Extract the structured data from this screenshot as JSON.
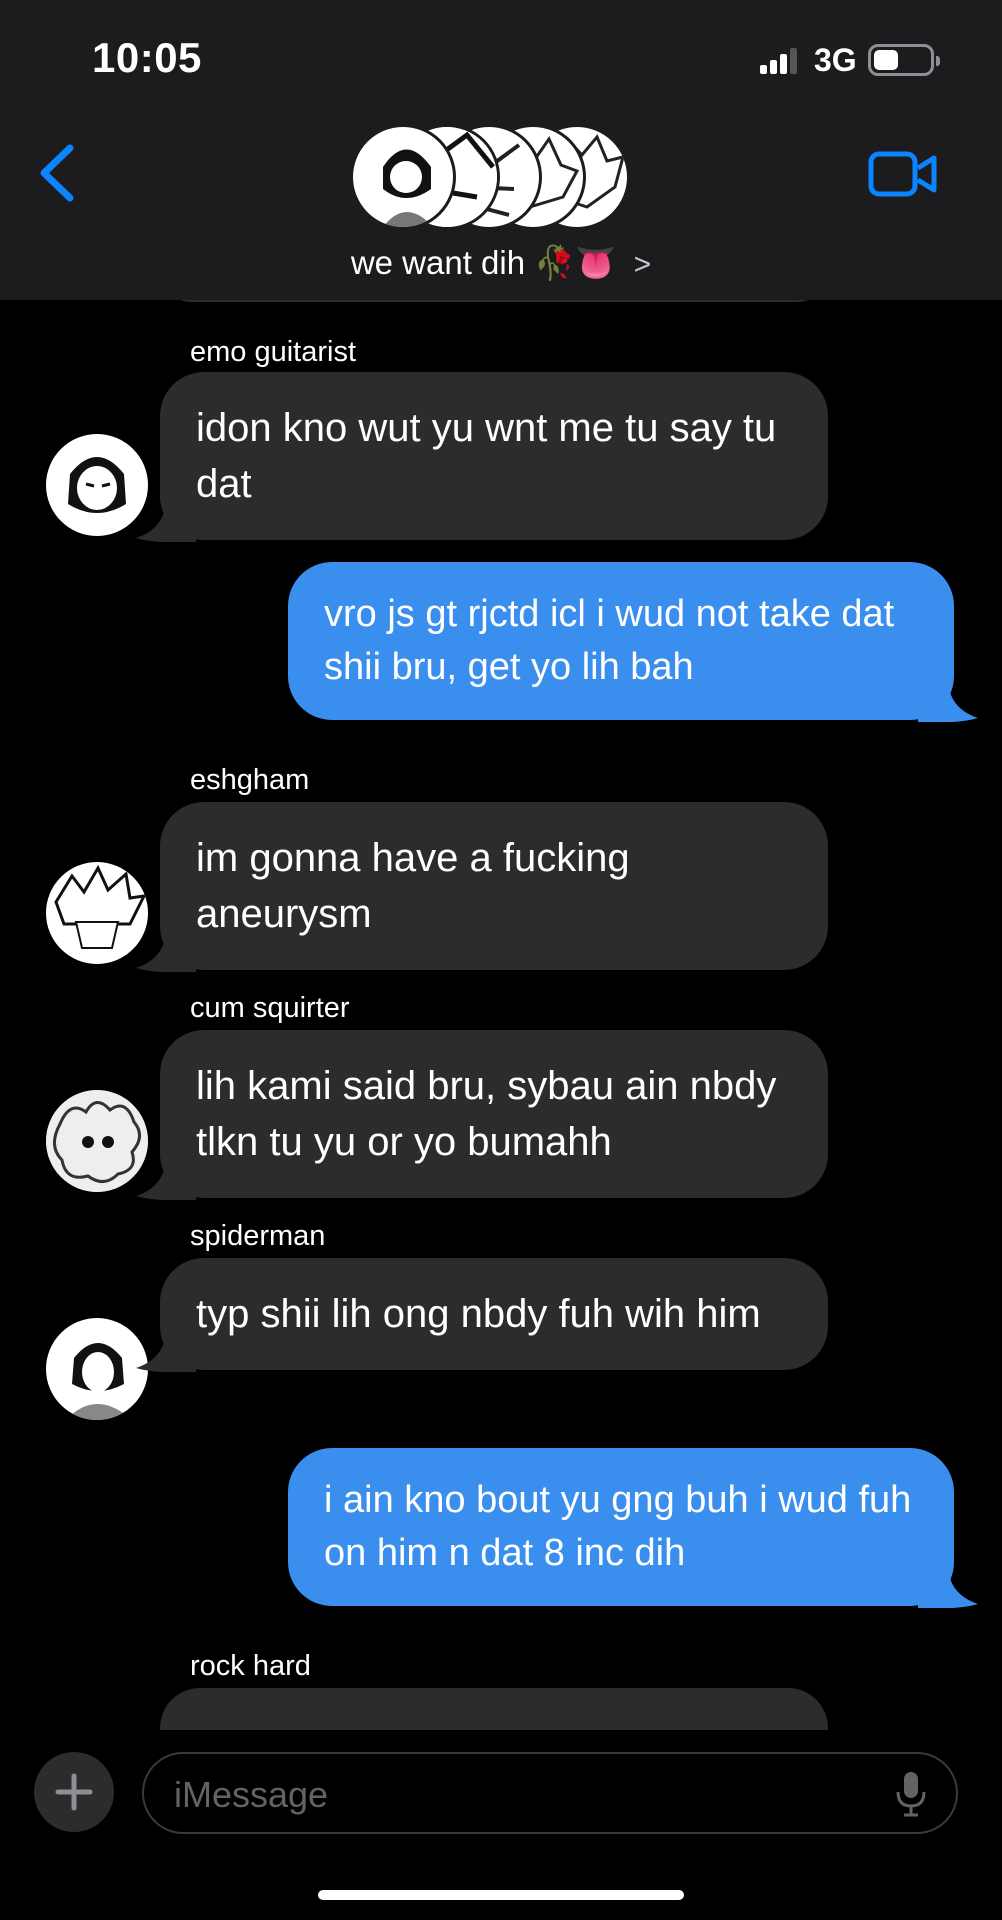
{
  "status": {
    "time": "10:05",
    "network": "3G"
  },
  "header": {
    "group_name": "we want dih",
    "group_emoji": "🥀👅",
    "chevron": ">"
  },
  "messages": [
    {
      "sender": "emo guitarist",
      "text": "idon kno wut yu wnt me tu say tu dat",
      "direction": "incoming"
    },
    {
      "text": "vro js gt rjctd icl i wud not take dat shii bru, get yo lih bah",
      "direction": "outgoing"
    },
    {
      "sender": "eshgham",
      "text": "im gonna have a fucking aneurysm",
      "direction": "incoming"
    },
    {
      "sender": "cum squirter",
      "text": "lih kami said bru, sybau ain nbdy tlkn tu yu or yo bumahh",
      "direction": "incoming"
    },
    {
      "sender": "spiderman",
      "text": "typ shii lih ong nbdy fuh wih him",
      "direction": "incoming"
    },
    {
      "text": "i ain kno bout yu gng buh i wud fuh on him n dat 8 inc dih",
      "direction": "outgoing"
    },
    {
      "sender": "rock hard",
      "text": "",
      "direction": "incoming"
    }
  ],
  "composer": {
    "placeholder": "iMessage"
  },
  "colors": {
    "accent": "#3a8fee",
    "incoming_bubble": "#2c2c2e",
    "header_bg": "#1c1c1e",
    "ios_blue": "#0a84ff"
  },
  "icons": [
    "back-chevron-icon",
    "video-camera-icon",
    "plus-icon",
    "microphone-icon",
    "signal-icon",
    "battery-icon"
  ]
}
